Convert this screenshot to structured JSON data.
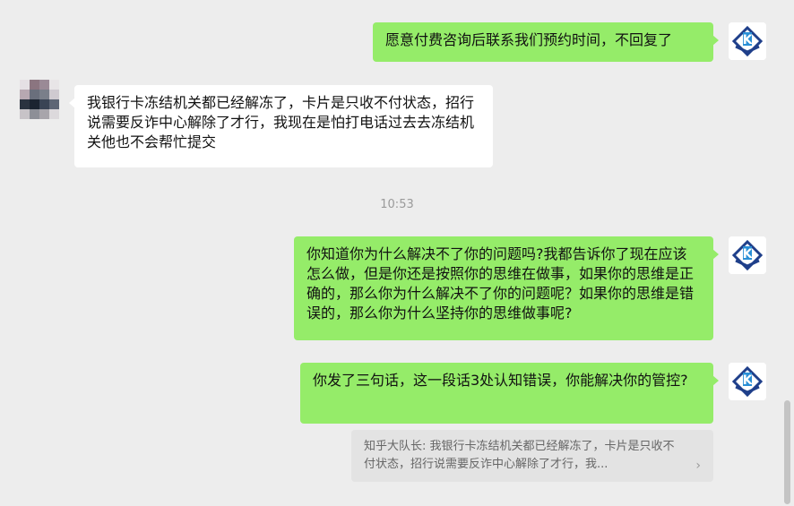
{
  "messages": {
    "m1": {
      "text": "愿意付费咨询后联系我们预约时间，不回复了"
    },
    "m2": {
      "text": "我银行卡冻结机关都已经解冻了，卡片是只收不付状态，招行说需要反诈中心解除了才行，我现在是怕打电话过去去冻结机关他也不会帮忙提交"
    },
    "m3": {
      "text": "你知道你为什么解决不了你的问题吗?我都告诉你了现在应该怎么做，但是你还是按照你的思维在做事，如果你的思维是正确的，那么你为什么解决不了你的问题呢？如果你的思维是错误的，那么你为什么坚持你的思维做事呢?"
    },
    "m4": {
      "text": "你发了三句话，这一段话3处认知错误，你能解决你的管控?"
    }
  },
  "timestamp": "10:53",
  "quote": {
    "text": "知乎大队长: 我银行卡冻结机关都已经解冻了，卡片是只收不付状态，招行说需要反诈中心解除了才行，我..."
  },
  "avatars": {
    "self_icon": "k-logo-icon",
    "other_icon": "pixelated-avatar-icon",
    "self_colors": {
      "primary": "#1f3f8a",
      "accent": "#2a8fd6"
    }
  },
  "colors": {
    "background": "#ededed",
    "outgoing_bubble": "#95ec69",
    "incoming_bubble": "#ffffff",
    "quote_bg": "#e3e3e3"
  }
}
